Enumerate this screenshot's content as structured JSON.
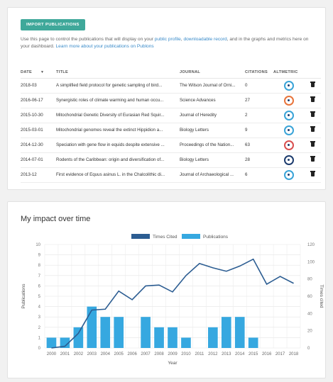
{
  "publications_card": {
    "import_button": "IMPORT PUBLICATIONS",
    "intro_prefix": "Use this page to control the publications that will display on your ",
    "intro_link1": "public profile",
    "intro_sep": ", ",
    "intro_link2": "downloadable record",
    "intro_mid": ", and in the graphs and metrics here on your dashboard. ",
    "intro_link3": "Learn more about your publications on Publons",
    "columns": {
      "date": "DATE",
      "title": "TITLE",
      "journal": "JOURNAL",
      "citations": "CITATIONS",
      "altmetric": "ALTMETRIC"
    },
    "rows": [
      {
        "date": "2018-03",
        "title": "A simplified field protocol for genetic sampling of bird...",
        "journal": "The Wilson Journal of Orni...",
        "citations": "0"
      },
      {
        "date": "2016-06-17",
        "title": "Synergistic roles of climate warming and human occu...",
        "journal": "Science Advances",
        "citations": "27"
      },
      {
        "date": "2015-10-30",
        "title": "Mitochondrial Genetic Diversity of Eurasian Red Squir...",
        "journal": "Journal of Heredity",
        "citations": "2"
      },
      {
        "date": "2015-03-01",
        "title": "Mitochondrial genomes reveal the extinct Hippidion a...",
        "journal": "Biology Letters",
        "citations": "9"
      },
      {
        "date": "2014-12-30",
        "title": "Speciation with gene flow in equids despite extensive ...",
        "journal": "Proceedings of the Nation...",
        "citations": "63"
      },
      {
        "date": "2014-07-01",
        "title": "Rodents of the Caribbean: origin and diversification of...",
        "journal": "Biology Letters",
        "citations": "28"
      },
      {
        "date": "2013-12",
        "title": "First evidence of Equus asinus L. in the Chalcolithic di...",
        "journal": "Journal of Archaeological ...",
        "citations": "6"
      }
    ]
  },
  "impact_card": {
    "title": "My impact over time"
  },
  "colors": {
    "accent": "#3fa89a",
    "times_cited": "#2c5d92",
    "publications": "#36a8e0"
  },
  "chart_data": {
    "type": "bar",
    "categories": [
      "2000",
      "2001",
      "2002",
      "2003",
      "2004",
      "2005",
      "2006",
      "2007",
      "2008",
      "2009",
      "2010",
      "2011",
      "2012",
      "2013",
      "2014",
      "2015",
      "2016",
      "2017",
      "2018"
    ],
    "series": [
      {
        "name": "Times Cited",
        "type": "line",
        "axis": "right",
        "values": [
          0,
          2,
          17,
          44,
          45,
          66,
          56,
          72,
          73,
          65,
          84,
          98,
          93,
          89,
          95,
          103,
          74,
          83,
          75
        ]
      },
      {
        "name": "Publications",
        "type": "bar",
        "axis": "left",
        "values": [
          1,
          1,
          2,
          4,
          3,
          3,
          0,
          3,
          2,
          2,
          1,
          0,
          2,
          3,
          3,
          1,
          0,
          0,
          0
        ]
      }
    ],
    "xlabel": "Year",
    "ylabel": "Publications",
    "y2label": "Times cited",
    "ylim": [
      0,
      10
    ],
    "y2lim": [
      0,
      120
    ],
    "yticks": [
      "0",
      "1",
      "2",
      "3",
      "4",
      "5",
      "6",
      "7",
      "8",
      "9",
      "10"
    ],
    "y2ticks": [
      "0",
      "20",
      "40",
      "60",
      "80",
      "100",
      "120"
    ],
    "grid": true,
    "legend": "top-center"
  }
}
